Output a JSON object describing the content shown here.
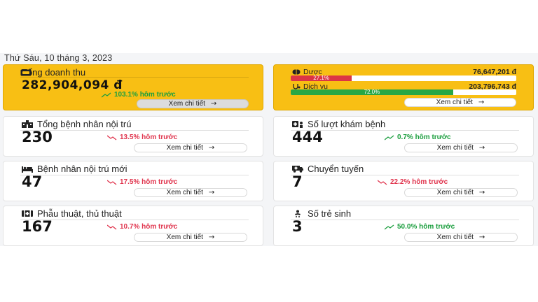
{
  "date": "Thứ Sáu, 10 tháng 3, 2023",
  "revenue": {
    "title": "Tổng doanh thu",
    "amount": "282,904,094 đ",
    "trend": "103.1% hôm trước",
    "trend_dir": "up",
    "button": "Xem chi tiết"
  },
  "services": {
    "items": [
      {
        "label": "Dược",
        "amount": "76,647,201 đ",
        "percent_text": "27.1%",
        "percent": 27.1,
        "color": "#dc3545",
        "icon": "pill-icon"
      },
      {
        "label": "Dịch vụ",
        "amount": "203,796,743 đ",
        "percent_text": "72.0%",
        "percent": 72.0,
        "color": "#28a745",
        "icon": "stethoscope-icon"
      }
    ],
    "button": "Xem chi tiết"
  },
  "stats": [
    {
      "key": "inpatient-total",
      "title": "Tổng bệnh nhân nội trú",
      "value": "230",
      "trend": "13.5% hôm trước",
      "trend_dir": "down",
      "button": "Xem chi tiết",
      "icon": "hospital-icon"
    },
    {
      "key": "exam-visits",
      "title": "Số lượt khám bệnh",
      "value": "444",
      "trend": "0.7% hôm trước",
      "trend_dir": "up",
      "button": "Xem chi tiết",
      "icon": "clinic-icon"
    },
    {
      "key": "inpatient-new",
      "title": "Bệnh nhân nội trú mới",
      "value": "47",
      "trend": "17.5% hôm trước",
      "trend_dir": "down",
      "button": "Xem chi tiết",
      "icon": "bed-icon"
    },
    {
      "key": "transfers",
      "title": "Chuyển tuyến",
      "value": "7",
      "trend": "22.2% hôm trước",
      "trend_dir": "down",
      "button": "Xem chi tiết",
      "icon": "ambulance-icon"
    },
    {
      "key": "surgery",
      "title": "Phẫu thuật, thủ thuật",
      "value": "167",
      "trend": "10.7% hôm trước",
      "trend_dir": "down",
      "button": "Xem chi tiết",
      "icon": "surgery-kit-icon"
    },
    {
      "key": "newborns",
      "title": "Số trẻ sinh",
      "value": "3",
      "trend": "50.0% hôm trước",
      "trend_dir": "up",
      "button": "Xem chi tiết",
      "icon": "baby-icon"
    }
  ]
}
